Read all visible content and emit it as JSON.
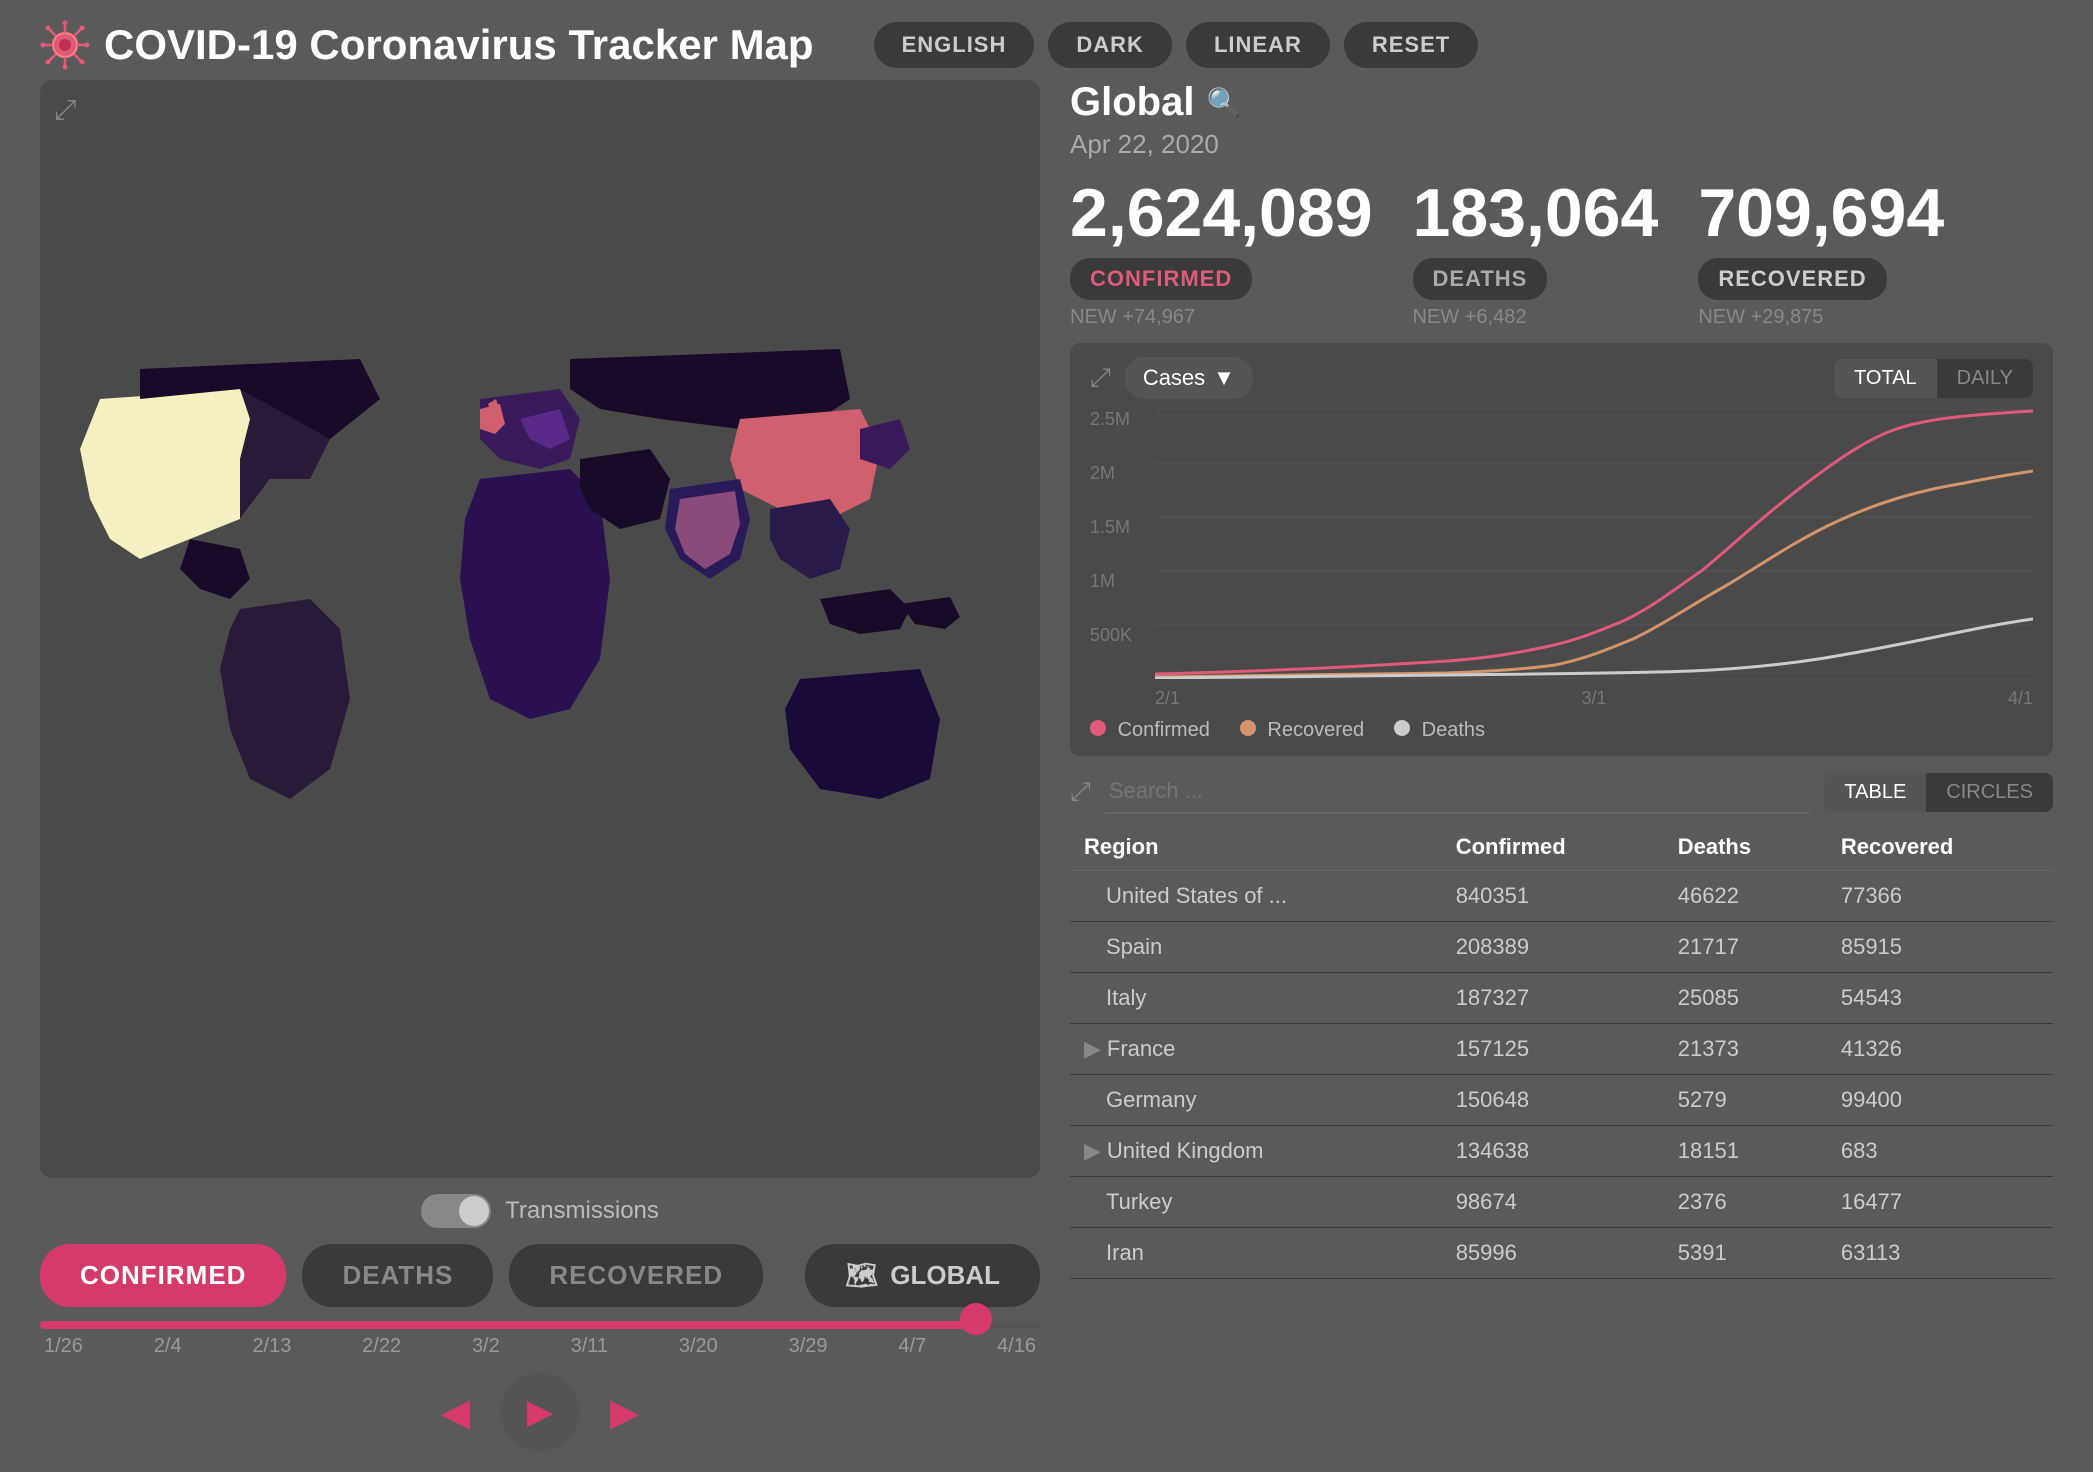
{
  "app": {
    "title": "COVID-19 Coronavirus Tracker Map",
    "icon": "🦠"
  },
  "toolbar": {
    "buttons": [
      "ENGLISH",
      "DARK",
      "LINEAR",
      "RESET"
    ]
  },
  "global": {
    "label": "Global",
    "date": "Apr 22, 2020"
  },
  "stats": {
    "confirmed": {
      "number": "2,624,089",
      "badge": "CONFIRMED",
      "new": "NEW +74,967"
    },
    "deaths": {
      "number": "183,064",
      "badge": "DEATHS",
      "new": "NEW +6,482"
    },
    "recovered": {
      "number": "709,694",
      "badge": "RECOVERED",
      "new": "NEW +29,875"
    }
  },
  "chart": {
    "dropdown_label": "Cases",
    "total_btn": "TOTAL",
    "daily_btn": "DAILY",
    "y_labels": [
      "2.5M",
      "2M",
      "1.5M",
      "1M",
      "500K",
      ""
    ],
    "x_labels": [
      "2/1",
      "3/1",
      "4/1"
    ],
    "legend": [
      {
        "label": "Confirmed",
        "color": "#e05a7a"
      },
      {
        "label": "Recovered",
        "color": "#d4946a"
      },
      {
        "label": "Deaths",
        "color": "#ccc"
      }
    ]
  },
  "table": {
    "search_placeholder": "Search ...",
    "table_btn": "TABLE",
    "circles_btn": "CIRCLES",
    "columns": [
      "Region",
      "Confirmed",
      "Deaths",
      "Recovered"
    ],
    "rows": [
      {
        "region": "United States of ...",
        "confirmed": "840351",
        "deaths": "46622",
        "recovered": "77366",
        "expandable": false
      },
      {
        "region": "Spain",
        "confirmed": "208389",
        "deaths": "21717",
        "recovered": "85915",
        "expandable": false
      },
      {
        "region": "Italy",
        "confirmed": "187327",
        "deaths": "25085",
        "recovered": "54543",
        "expandable": false
      },
      {
        "region": "France",
        "confirmed": "157125",
        "deaths": "21373",
        "recovered": "41326",
        "expandable": true
      },
      {
        "region": "Germany",
        "confirmed": "150648",
        "deaths": "5279",
        "recovered": "99400",
        "expandable": false
      },
      {
        "region": "United Kingdom",
        "confirmed": "134638",
        "deaths": "18151",
        "recovered": "683",
        "expandable": true
      },
      {
        "region": "Turkey",
        "confirmed": "98674",
        "deaths": "2376",
        "recovered": "16477",
        "expandable": false
      },
      {
        "region": "Iran",
        "confirmed": "85996",
        "deaths": "5391",
        "recovered": "63113",
        "expandable": false
      }
    ]
  },
  "map": {
    "transmissions_label": "Transmissions"
  },
  "bottom_tabs": {
    "confirmed": "CONFIRMED",
    "deaths": "DEATHS",
    "recovered": "RECOVERED",
    "global_icon": "🗺",
    "global_label": "GLOBAL"
  },
  "timeline": {
    "labels": [
      "1/26",
      "2/4",
      "2/13",
      "2/22",
      "3/2",
      "3/11",
      "3/20",
      "3/29",
      "4/7",
      "4/16"
    ],
    "value": 95
  },
  "colors": {
    "confirmed": "#d63a6a",
    "accent": "#d63a6a",
    "bg_dark": "#3a3a3a",
    "bg_panel": "#4a4a4a",
    "bg_body": "#5a5a5a"
  }
}
